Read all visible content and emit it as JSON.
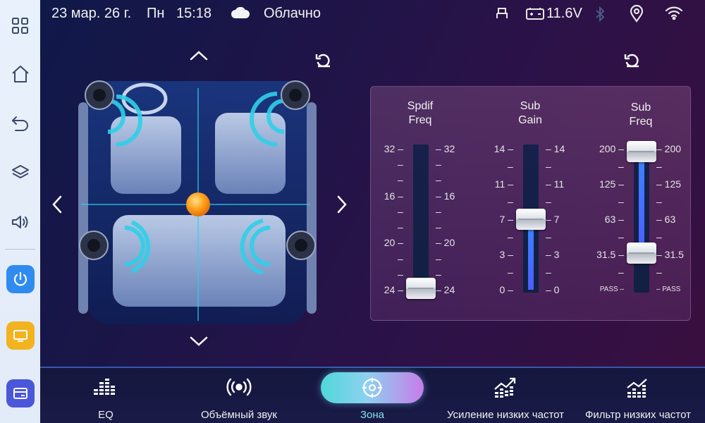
{
  "status": {
    "date": "23 мар. 26 г.",
    "weekday": "Пн",
    "time": "15:18",
    "weather": "Облачно",
    "voltage": "11.6V"
  },
  "sidebar": {
    "items": [
      {
        "icon": "grid-icon"
      },
      {
        "icon": "home-icon"
      },
      {
        "icon": "back-icon"
      },
      {
        "icon": "layers-icon"
      },
      {
        "icon": "volume-icon"
      }
    ],
    "apps": [
      {
        "icon": "power-icon",
        "color": "#2f8bf0"
      },
      {
        "icon": "monitor-icon",
        "color": "#f2b320"
      },
      {
        "icon": "card-icon",
        "color": "#4a57d8"
      }
    ]
  },
  "sliders": [
    {
      "title_line1": "Spdif",
      "title_line2": "Freq",
      "ticks": [
        "32",
        "16",
        "20",
        "24"
      ],
      "value": "24",
      "level": 0.0
    },
    {
      "title_line1": "Sub",
      "title_line2": "Gain",
      "ticks": [
        "14",
        "11",
        "7",
        "3",
        "0"
      ],
      "value": "7",
      "level": 0.5
    },
    {
      "title_line1": "Sub",
      "title_line2": "Freq",
      "ticks": [
        "200",
        "125",
        "63",
        "31.5",
        "PASS"
      ],
      "value_high": "200",
      "value_low": "31.5",
      "level": 1.0
    }
  ],
  "nav": [
    {
      "label": "EQ",
      "icon": "eq-icon"
    },
    {
      "label": "Объёмный звук",
      "icon": "surround-icon"
    },
    {
      "label": "Зона",
      "icon": "zone-icon",
      "active": true
    },
    {
      "label": "Усиление низких частот",
      "icon": "bass-boost-icon"
    },
    {
      "label": "Фильтр низких частот",
      "icon": "lowpass-icon"
    }
  ],
  "colors": {
    "accent": "#2fd0e8",
    "knob": "#ff9a1a",
    "slider_fill": "#3a86ff"
  }
}
